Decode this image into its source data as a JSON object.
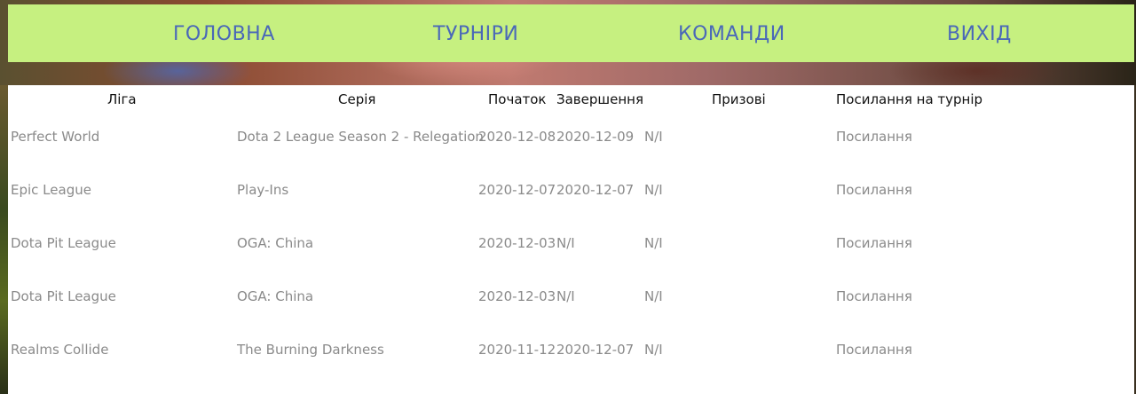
{
  "nav": {
    "items": [
      {
        "label": "ГОЛОВНА"
      },
      {
        "label": "ТУРНІРИ"
      },
      {
        "label": "КОМАНДИ"
      },
      {
        "label": "ВИХІД"
      }
    ]
  },
  "colors": {
    "nav_bg": "#c6f080",
    "nav_text": "#4a68b8",
    "cell_text": "#8a8a8a",
    "header_text": "#111111"
  },
  "table": {
    "headers": {
      "league": "Ліга",
      "series": "Серія",
      "start": "Початок",
      "end": "Завершення",
      "prize": "Призові",
      "link": "Посилання на турнір"
    },
    "rows": [
      {
        "league": "Perfect World",
        "series": "Dota 2 League Season 2 - Relegation",
        "start": "2020-12-08",
        "end": "2020-12-09",
        "prize": "N/I",
        "link": "Посилання"
      },
      {
        "league": "Epic League",
        "series": "Play-Ins",
        "start": "2020-12-07",
        "end": "2020-12-07",
        "prize": "N/I",
        "link": "Посилання"
      },
      {
        "league": "Dota Pit League",
        "series": "OGA: China",
        "start": "2020-12-03",
        "end": "N/I",
        "prize": "N/I",
        "link": "Посилання"
      },
      {
        "league": "Dota Pit League",
        "series": "OGA: China",
        "start": "2020-12-03",
        "end": "N/I",
        "prize": "N/I",
        "link": "Посилання"
      },
      {
        "league": "Realms Collide",
        "series": "The Burning Darkness",
        "start": "2020-11-12",
        "end": "2020-12-07",
        "prize": "N/I",
        "link": "Посилання"
      }
    ]
  }
}
